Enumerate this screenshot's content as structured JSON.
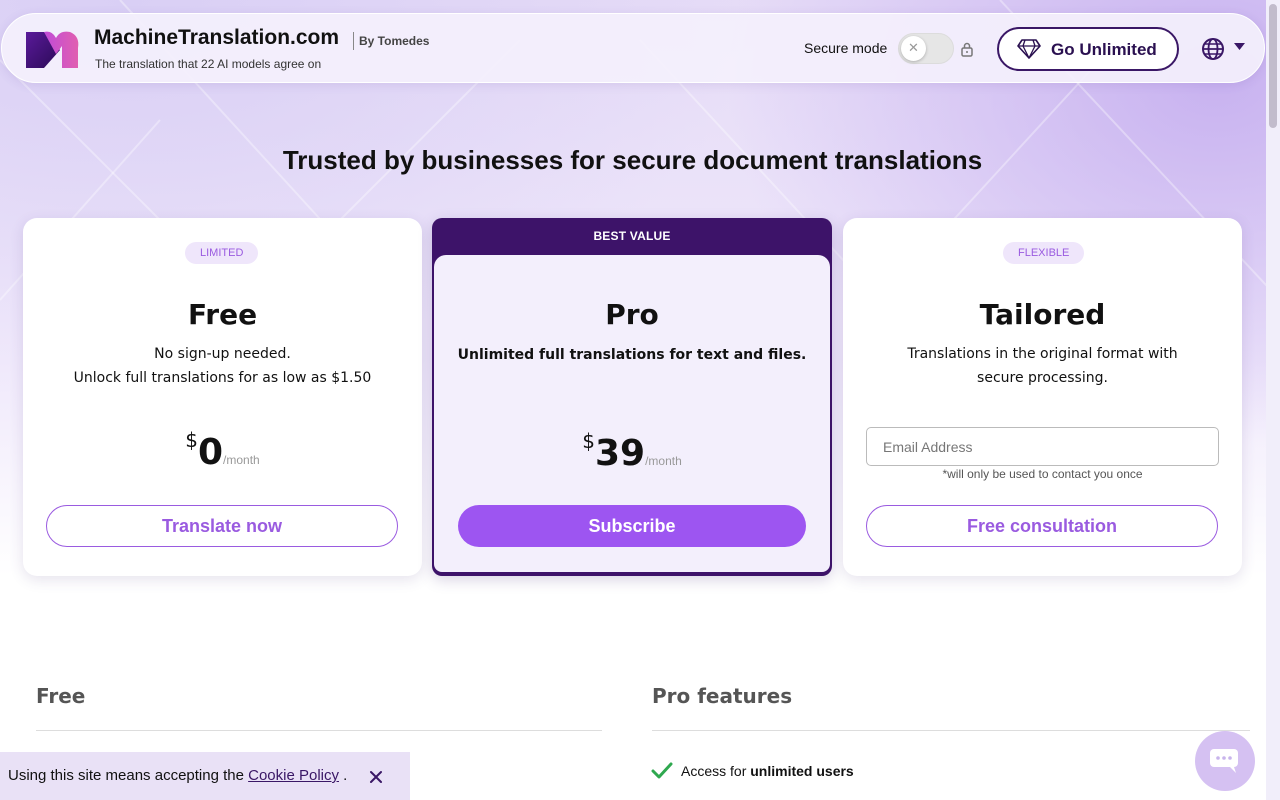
{
  "header": {
    "brand": "MachineTranslation.com",
    "by": "By Tomedes",
    "tagline": "The translation that 22 AI models agree on",
    "secure_mode_label": "Secure mode",
    "secure_mode_on": false,
    "go_unlimited_label": "Go Unlimited",
    "icons": [
      "logo",
      "lock-icon",
      "diamond-icon",
      "globe-icon",
      "chevron-down-icon"
    ]
  },
  "headline": "Trusted by businesses for secure document translations",
  "plans": {
    "free": {
      "badge": "LIMITED",
      "name": "Free",
      "desc_line1": "No sign-up needed.",
      "desc_line2": "Unlock full translations for as low as $1.50",
      "currency": "$",
      "amount": "0",
      "period": "/month",
      "cta": "Translate now"
    },
    "pro": {
      "ribbon": "BEST VALUE",
      "name": "Pro",
      "desc": "Unlimited full translations for text and files.",
      "currency": "$",
      "amount": "39",
      "period": "/month",
      "cta": "Subscribe"
    },
    "tailored": {
      "badge": "FLEXIBLE",
      "name": "Tailored",
      "desc": "Translations in the original format with secure processing.",
      "email_placeholder": "Email Address",
      "email_value": "",
      "email_note": "*will only be used to contact you once",
      "cta": "Free consultation"
    }
  },
  "features": {
    "free_title": "Free",
    "pro_title": "Pro features",
    "pro_items": [
      {
        "prefix": "Access for ",
        "bold": "unlimited users"
      }
    ]
  },
  "cookie": {
    "text": "Using this site means accepting the ",
    "link": "Cookie Policy",
    "suffix": " ."
  },
  "colors": {
    "accent": "#9d55f1",
    "dark_purple": "#3d1369",
    "badge_bg": "#efe6fb",
    "check_green": "#2fa84f"
  }
}
